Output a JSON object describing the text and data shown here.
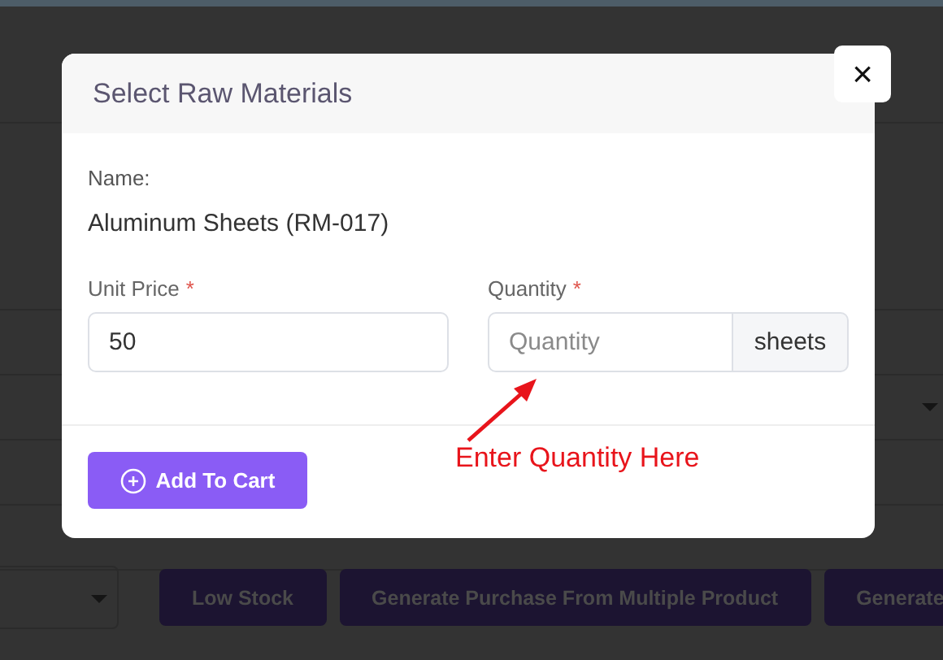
{
  "background": {
    "buttons": [
      "Low Stock",
      "Generate Purchase From Multiple Product",
      "Generate"
    ]
  },
  "modal": {
    "title": "Select Raw Materials",
    "close_label": "×",
    "name_label": "Name:",
    "name_value": "Aluminum Sheets (RM-017)",
    "fields": [
      {
        "kind": "text",
        "label": "Unit Price",
        "required_mark": "*",
        "value": "50"
      },
      {
        "kind": "addon",
        "label": "Quantity",
        "required_mark": "*",
        "placeholder": "Quantity",
        "unit": "sheets"
      }
    ],
    "submit_button": "Add To Cart"
  },
  "annotation": "Enter Quantity Here"
}
